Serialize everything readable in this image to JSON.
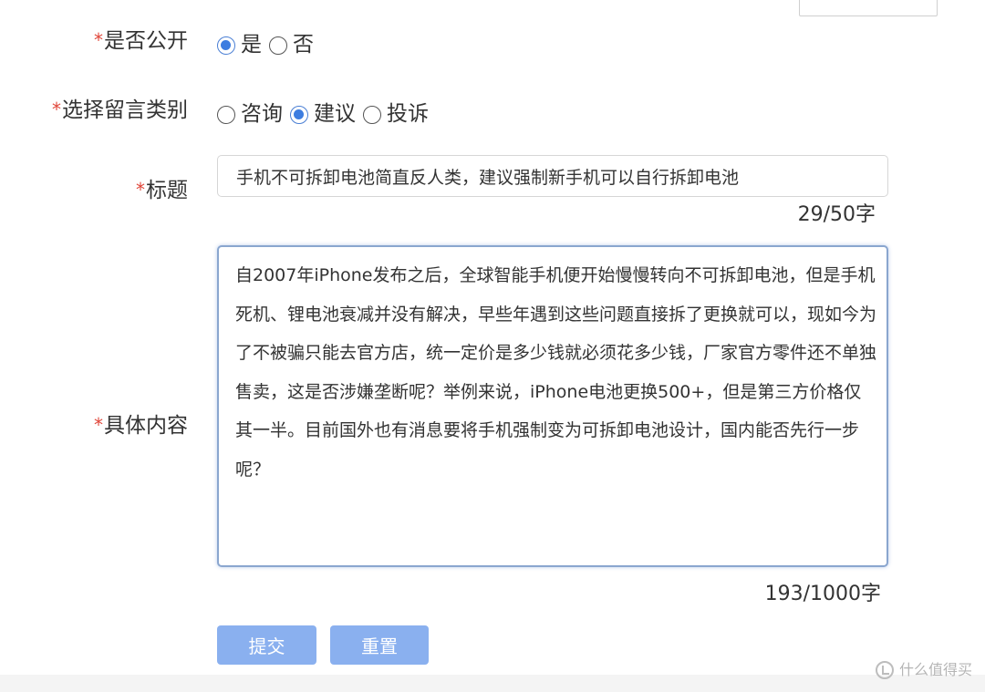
{
  "form": {
    "required_mark": "*",
    "public": {
      "label": "是否公开",
      "options": [
        {
          "label": "是",
          "checked": true
        },
        {
          "label": "否",
          "checked": false
        }
      ]
    },
    "category": {
      "label": "选择留言类别",
      "options": [
        {
          "label": "咨询",
          "checked": false
        },
        {
          "label": "建议",
          "checked": true
        },
        {
          "label": "投诉",
          "checked": false
        }
      ]
    },
    "title": {
      "label": "标题",
      "value": "手机不可拆卸电池简直反人类，建议强制新手机可以自行拆卸电池",
      "counter": "29/50字"
    },
    "content": {
      "label": "具体内容",
      "value": "自2007年iPhone发布之后，全球智能手机便开始慢慢转向不可拆卸电池，但是手机死机、锂电池衰减并没有解决，早些年遇到这些问题直接拆了更换就可以，现如今为了不被骗只能去官方店，统一定价是多少钱就必须花多少钱，厂家官方零件还不单独售卖，这是否涉嫌垄断呢？举例来说，iPhone电池更换500+，但是第三方价格仅其一半。目前国外也有消息要将手机强制变为可拆卸电池设计，国内能否先行一步呢？",
      "counter": "193/1000字"
    },
    "buttons": {
      "submit": "提交",
      "reset": "重置"
    }
  },
  "watermark": {
    "text": "什么值得买"
  },
  "colors": {
    "accent": "#3d7de0",
    "button_bg": "#8ab0ef",
    "required": "#e0463a"
  }
}
